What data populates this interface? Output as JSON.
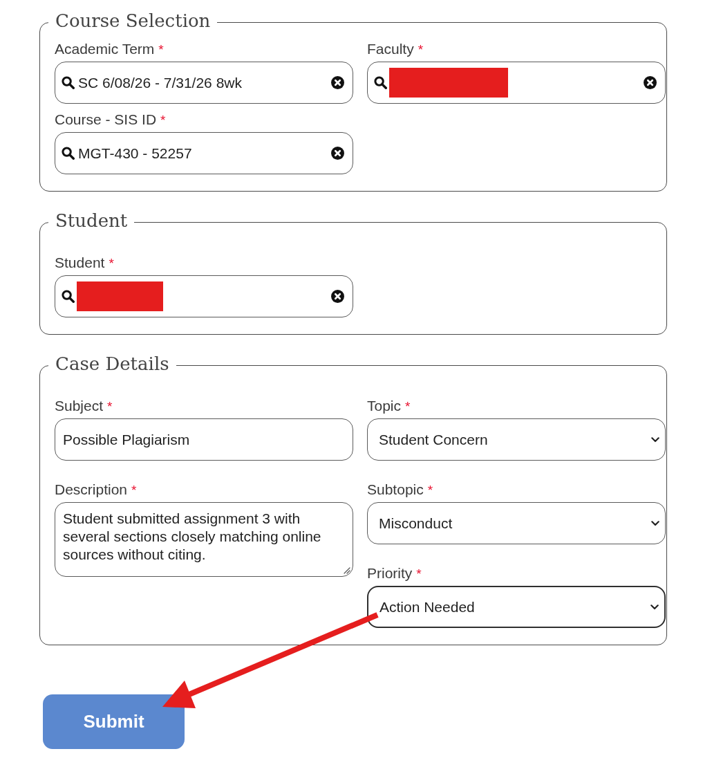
{
  "sections": [
    {
      "title": "Course Selection",
      "columns": [
        {
          "fields": [
            {
              "kind": "search",
              "label": "Academic Term",
              "required_mark": "*",
              "value": "SC 6/08/26 - 7/31/26 8wk",
              "redacted": false,
              "focused": false
            },
            {
              "kind": "search",
              "label": "Course - SIS ID",
              "required_mark": "*",
              "value": "MGT-430 - 52257",
              "redacted": false,
              "focused": false
            }
          ]
        },
        {
          "fields": [
            {
              "kind": "search",
              "label": "Faculty",
              "required_mark": "*",
              "redacted": true,
              "focused": false
            }
          ]
        }
      ]
    },
    {
      "title": "Student",
      "columns": [
        {
          "fields": [
            {
              "kind": "search",
              "label": "Student",
              "required_mark": "*",
              "redacted": true,
              "focused": false
            }
          ]
        }
      ]
    },
    {
      "title": "Case Details",
      "columns": [
        {
          "fields": [
            {
              "kind": "text",
              "label": "Subject",
              "required_mark": "*",
              "value": "Possible Plagiarism",
              "redacted": false,
              "focused": false
            },
            {
              "kind": "textarea",
              "label": "Description",
              "required_mark": "*",
              "value": "Student submitted assignment 3 with several sections closely matching online sources without citing.",
              "redacted": false,
              "focused": false
            }
          ]
        },
        {
          "fields": [
            {
              "kind": "select",
              "label": "Topic",
              "required_mark": "*",
              "value": "Student Concern",
              "redacted": false,
              "focused": false
            },
            {
              "kind": "select",
              "label": "Subtopic",
              "required_mark": "*",
              "value": "Misconduct",
              "redacted": false,
              "focused": false
            },
            {
              "kind": "select",
              "label": "Priority",
              "required_mark": "*",
              "value": "Action Needed",
              "redacted": false,
              "focused": true
            }
          ]
        }
      ]
    }
  ],
  "submit_button": {
    "label": "Submit"
  }
}
